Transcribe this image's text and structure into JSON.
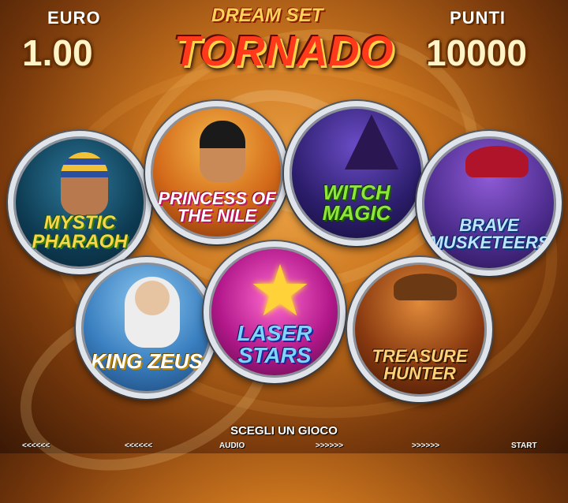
{
  "hud": {
    "currency_label": "EURO",
    "credit_value": "1.00",
    "points_label": "PUNTI",
    "points_value": "10000"
  },
  "logo": {
    "subtitle": "DREAM SET",
    "title": "TORNADO"
  },
  "games": [
    {
      "title": "MYSTIC PHARAOH"
    },
    {
      "title": "PRINCESS OF THE NILE"
    },
    {
      "title": "WITCH MAGIC"
    },
    {
      "title": "BRAVE MUSKETEERS"
    },
    {
      "title": "KING ZEUS"
    },
    {
      "title": "LASER STARS"
    },
    {
      "title": "TREASURE HUNTER"
    }
  ],
  "prompt": "SCEGLI UN GIOCO",
  "buttons": {
    "prev_1": "<<<<<<",
    "prev_2": "<<<<<<",
    "audio": "AUDIO",
    "next_1": ">>>>>>",
    "next_2": ">>>>>>",
    "start": "START"
  },
  "colors": {
    "background": "#c9741e",
    "title_red": "#ff3a1a",
    "ring_silver": "#dfe3ea"
  }
}
